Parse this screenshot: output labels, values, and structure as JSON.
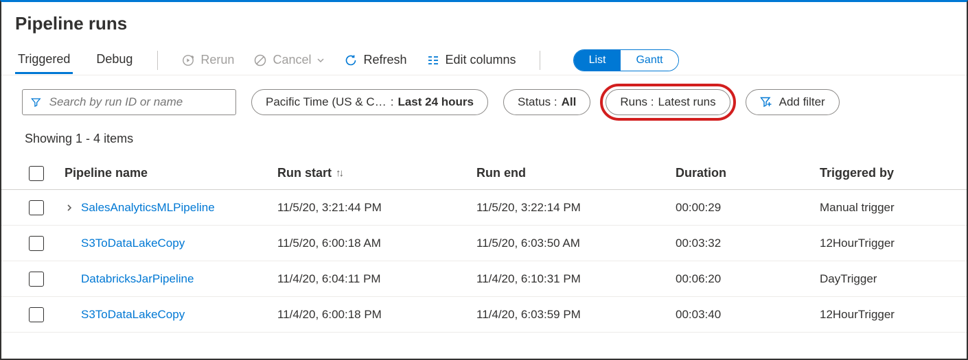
{
  "page_title": "Pipeline runs",
  "tabs": {
    "triggered": "Triggered",
    "debug": "Debug"
  },
  "toolbar": {
    "rerun": "Rerun",
    "cancel": "Cancel",
    "refresh": "Refresh",
    "edit_columns": "Edit columns"
  },
  "view_toggle": {
    "list": "List",
    "gantt": "Gantt"
  },
  "filters": {
    "search_placeholder": "Search by run ID or name",
    "time_label": "Pacific Time (US & C…",
    "time_sep": " : ",
    "time_value": "Last 24 hours",
    "status_label": "Status : ",
    "status_value": "All",
    "runs_label": "Runs : ",
    "runs_value": "Latest runs",
    "add_filter": "Add filter"
  },
  "count_text": "Showing 1 - 4 items",
  "columns": {
    "name": "Pipeline name",
    "run_start": "Run start",
    "run_end": "Run end",
    "duration": "Duration",
    "triggered_by": "Triggered by"
  },
  "rows": [
    {
      "expandable": true,
      "name": "SalesAnalyticsMLPipeline",
      "run_start": "11/5/20, 3:21:44 PM",
      "run_end": "11/5/20, 3:22:14 PM",
      "duration": "00:00:29",
      "triggered_by": "Manual trigger"
    },
    {
      "expandable": false,
      "name": "S3ToDataLakeCopy",
      "run_start": "11/5/20, 6:00:18 AM",
      "run_end": "11/5/20, 6:03:50 AM",
      "duration": "00:03:32",
      "triggered_by": "12HourTrigger"
    },
    {
      "expandable": false,
      "name": "DatabricksJarPipeline",
      "run_start": "11/4/20, 6:04:11 PM",
      "run_end": "11/4/20, 6:10:31 PM",
      "duration": "00:06:20",
      "triggered_by": "DayTrigger"
    },
    {
      "expandable": false,
      "name": "S3ToDataLakeCopy",
      "run_start": "11/4/20, 6:00:18 PM",
      "run_end": "11/4/20, 6:03:59 PM",
      "duration": "00:03:40",
      "triggered_by": "12HourTrigger"
    }
  ]
}
